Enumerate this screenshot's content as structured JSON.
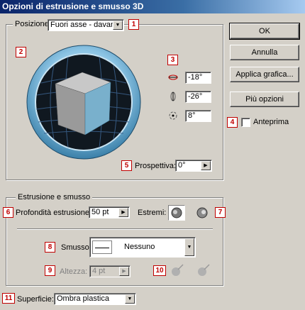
{
  "window": {
    "title": "Opzioni di estrusione e smusso 3D"
  },
  "position": {
    "label": "Posizione",
    "value": "Fuori asse - davanti"
  },
  "rotation": {
    "x": "-18°",
    "y": "-26°",
    "z": "8°"
  },
  "perspective": {
    "label": "Prospettiva:",
    "value": "0°"
  },
  "buttons": {
    "ok": "OK",
    "cancel": "Annulla",
    "apply_graphic": "Applica grafica...",
    "more_options": "Più opzioni"
  },
  "preview": {
    "label": "Anteprima",
    "checked": false
  },
  "extrude": {
    "group_label": "Estrusione e smusso",
    "depth_label": "Profondità estrusione:",
    "depth_value": "50 pt",
    "caps_label": "Estremi:"
  },
  "bevel": {
    "label": "Smusso:",
    "value": "Nessuno"
  },
  "height": {
    "label": "Altezza:",
    "value": "4 pt"
  },
  "surface": {
    "label": "Superficie:",
    "value": "Ombra plastica"
  },
  "badges": [
    "1",
    "2",
    "3",
    "4",
    "5",
    "6",
    "7",
    "8",
    "9",
    "10",
    "11"
  ],
  "colors": {
    "title_bar": "#0a246a",
    "badge_red": "#c00000",
    "cube_blue": "#79b0cc",
    "ring_blue": "#5fa7d1"
  }
}
